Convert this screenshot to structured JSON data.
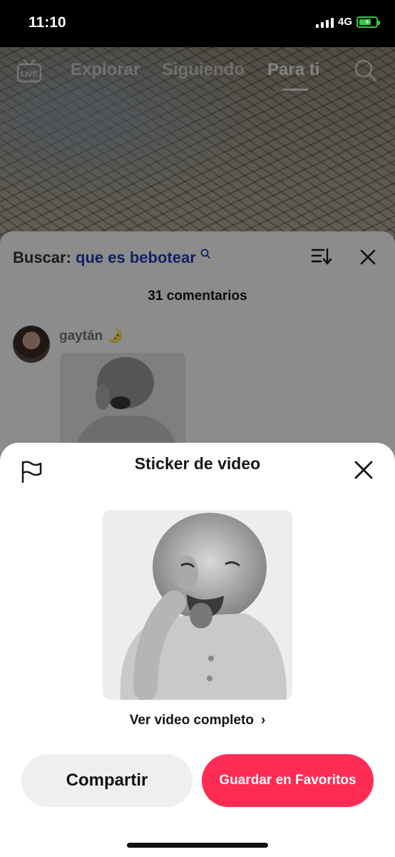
{
  "status_bar": {
    "time": "11:10",
    "network": "4G"
  },
  "top_nav": {
    "live_label": "LIVE",
    "tabs": [
      {
        "label": "Explorar"
      },
      {
        "label": "Siguiendo"
      },
      {
        "label": "Para ti",
        "active": true
      }
    ]
  },
  "comments": {
    "search_label": "Buscar:",
    "search_query": "que es bebotear",
    "count_label": "31 comentarios",
    "items": [
      {
        "username": "gaytán 🌛"
      }
    ]
  },
  "sheet": {
    "title": "Sticker de video",
    "view_full_label": "Ver video completo",
    "share_label": "Compartir",
    "favorite_label": "Guardar en Favoritos"
  },
  "colors": {
    "accent": "#fe2c55",
    "search_query": "#1d3fb8",
    "battery": "#2ecc40"
  }
}
